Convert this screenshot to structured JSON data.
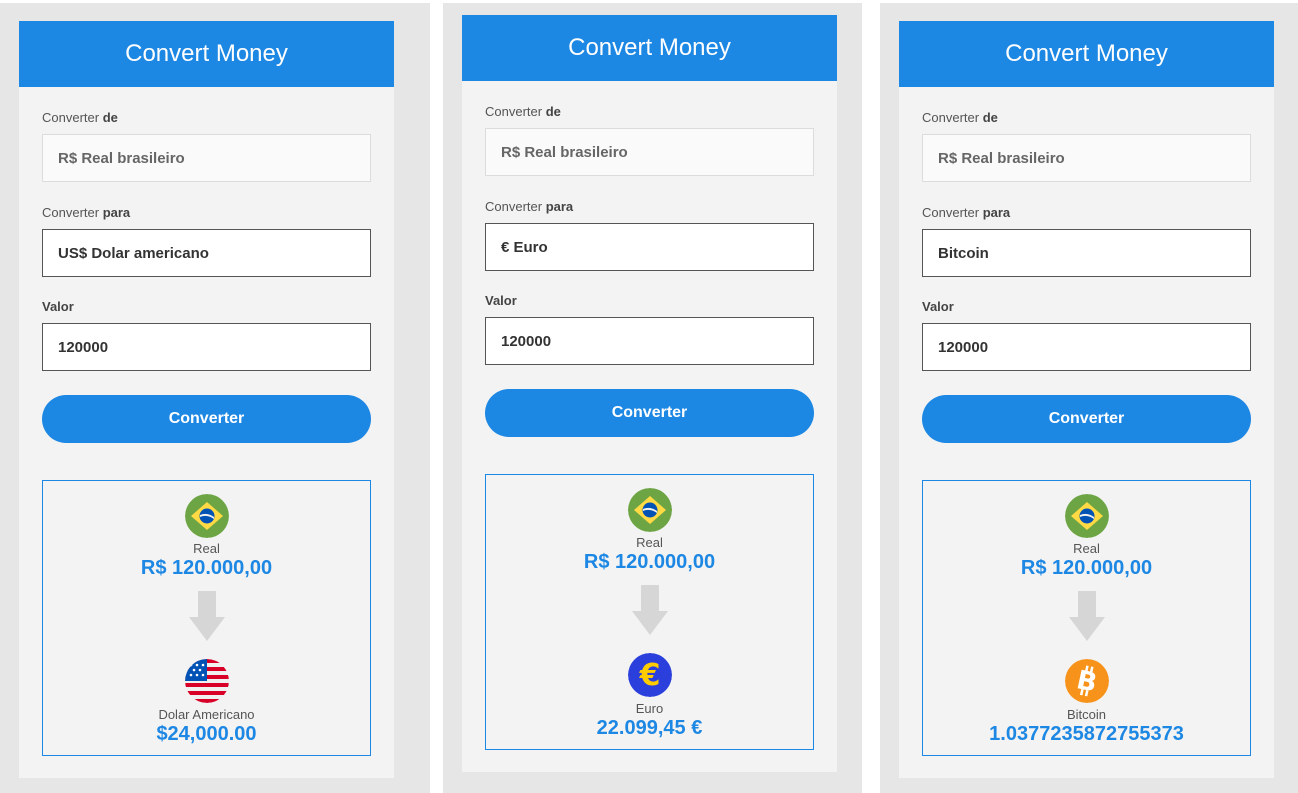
{
  "cards": [
    {
      "title": "Convert Money",
      "from_label_prefix": "Converter ",
      "from_label_bold": "de",
      "from_value": "R$ Real brasileiro",
      "to_label_prefix": "Converter ",
      "to_label_bold": "para",
      "to_value": "US$ Dolar americano",
      "amount_label": "Valor",
      "amount_value": "120000",
      "button_label": "Converter",
      "result": {
        "source_icon": "brazil-flag-icon",
        "source_name": "Real",
        "source_value": "R$ 120.000,00",
        "target_icon": "usa-flag-icon",
        "target_name": "Dolar Americano",
        "target_value": "$24,000.00"
      }
    },
    {
      "title": "Convert Money",
      "from_label_prefix": "Converter ",
      "from_label_bold": "de",
      "from_value": "R$ Real brasileiro",
      "to_label_prefix": "Converter ",
      "to_label_bold": "para",
      "to_value": "€ Euro",
      "amount_label": "Valor",
      "amount_value": "120000",
      "button_label": "Converter",
      "result": {
        "source_icon": "brazil-flag-icon",
        "source_name": "Real",
        "source_value": "R$ 120.000,00",
        "target_icon": "euro-coin-icon",
        "target_name": "Euro",
        "target_value": "22.099,45 €"
      }
    },
    {
      "title": "Convert Money",
      "from_label_prefix": "Converter ",
      "from_label_bold": "de",
      "from_value": "R$ Real brasileiro",
      "to_label_prefix": "Converter ",
      "to_label_bold": "para",
      "to_value": "Bitcoin",
      "amount_label": "Valor",
      "amount_value": "120000",
      "button_label": "Converter",
      "result": {
        "source_icon": "brazil-flag-icon",
        "source_name": "Real",
        "source_value": "R$ 120.000,00",
        "target_icon": "bitcoin-icon",
        "target_name": "Bitcoin",
        "target_value": "1.0377235872755373"
      }
    }
  ],
  "colors": {
    "accent": "#1d87e4",
    "panel_bg": "#e6e6e6",
    "card_bg": "#f3f3f3"
  }
}
